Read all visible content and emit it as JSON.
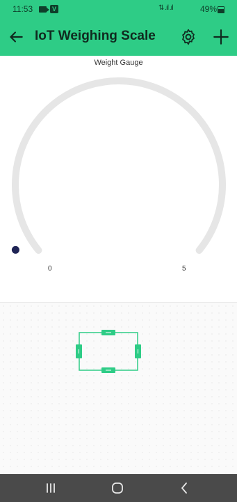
{
  "status_bar": {
    "time": "11:53",
    "signal": "⇅ .ıl .ıl",
    "battery": "49%"
  },
  "app_bar": {
    "title": "IoT Weighing Scale"
  },
  "gauge": {
    "title": "Weight Gauge",
    "min": "0",
    "max": "5",
    "value": 0,
    "track_color": "#e6e6e6",
    "indicator_color": "#1f2455"
  },
  "colors": {
    "accent": "#2ecc86",
    "nav_bar": "#4a4a4a"
  },
  "icons": [
    "back-arrow-icon",
    "gear-icon",
    "plus-icon",
    "recent-apps-icon",
    "home-icon",
    "back-nav-icon"
  ]
}
